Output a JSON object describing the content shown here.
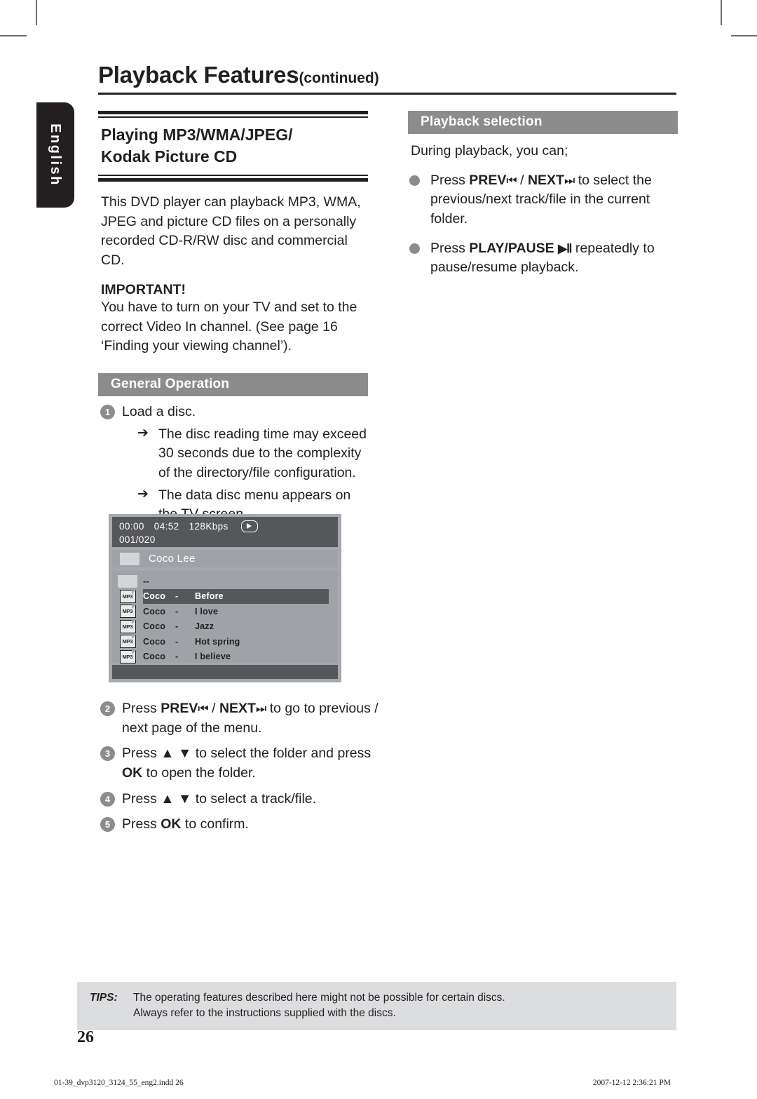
{
  "page": {
    "language_tab": "English",
    "header_title": "Playback Features",
    "header_continued": "(continued)",
    "page_number": "26"
  },
  "left_column": {
    "section_title_line1": "Playing MP3/WMA/JPEG/",
    "section_title_line2": "Kodak Picture CD",
    "intro_paragraph": "This DVD player can playback MP3, WMA, JPEG and picture CD files on a personally recorded CD-R/RW disc and commercial CD.",
    "important_label": "IMPORTANT!",
    "important_paragraph": "You have to turn on your TV and set to the correct Video In channel.  (See page 16 ‘Finding your viewing channel’).",
    "general_operation_bar": "General Operation",
    "steps": [
      {
        "num": "1",
        "text": "Load a disc.",
        "sub_items": [
          "The disc reading time may exceed 30 seconds due to the complexity of the directory/file configuration.",
          "The data disc menu appears on the TV screen."
        ]
      },
      {
        "num": "2",
        "text_pre": "Press ",
        "bold1": "PREV",
        "glyph1": "⏮",
        "mid": " / ",
        "bold2": "NEXT",
        "glyph2": "⏭",
        "text_post": " to go to previous / next page of the menu."
      },
      {
        "num": "3",
        "text_pre": "Press ",
        "glyph1": "▲",
        "glyph2": "▼",
        "mid": " to select the folder and press ",
        "bold1": "OK",
        "text_post": " to open the folder."
      },
      {
        "num": "4",
        "text_pre": "Press ",
        "glyph1": "▲",
        "glyph2": "▼",
        "text_post": " to select a track/file."
      },
      {
        "num": "5",
        "text_pre": "Press ",
        "bold1": "OK",
        "text_post": " to confirm."
      }
    ]
  },
  "tv_screen": {
    "status": {
      "elapsed_time": "00:00",
      "total_time": "04:52",
      "bitrate": "128Kbps",
      "play_icon": "play-icon",
      "track_counter": "001/020"
    },
    "current_folder": "Coco Lee",
    "rows": [
      {
        "icon": "folder-up-icon",
        "artist": "--",
        "dash": "",
        "title": "",
        "selected": false
      },
      {
        "icon": "mp3-file-icon",
        "label": "MP3",
        "artist": "Coco",
        "dash": "-",
        "title": "Before",
        "selected": true
      },
      {
        "icon": "mp3-file-icon",
        "label": "MP3",
        "artist": "Coco",
        "dash": "-",
        "title": "I love",
        "selected": false
      },
      {
        "icon": "mp3-file-icon",
        "label": "MP3",
        "artist": "Coco",
        "dash": "-",
        "title": "Jazz",
        "selected": false
      },
      {
        "icon": "mp3-file-icon",
        "label": "MP3",
        "artist": "Coco",
        "dash": "-",
        "title": "Hot spring",
        "selected": false
      },
      {
        "icon": "mp3-file-icon",
        "label": "MP3",
        "artist": "Coco",
        "dash": "-",
        "title": "I believe",
        "selected": false
      }
    ]
  },
  "right_column": {
    "playback_selection_bar": "Playback selection",
    "intro": "During playback, you can;",
    "bullets": [
      {
        "text_pre": "Press ",
        "bold1": "PREV",
        "glyph1": "⏮",
        "mid": " / ",
        "bold2": "NEXT",
        "glyph2": "⏭",
        "text_post": " to select the previous/next track/file in the current folder."
      },
      {
        "text_pre": "Press ",
        "bold1": "PLAY/PAUSE",
        "glyph1": "▶Ⅱ",
        "text_post": " repeatedly to pause/resume playback."
      }
    ]
  },
  "tips": {
    "label": "TIPS:",
    "line1": "The operating features described here might not be possible for certain discs.",
    "line2": "Always refer to the instructions supplied with the discs."
  },
  "print_footer": {
    "left": "01-39_dvp3120_3124_55_eng2.indd  26",
    "right": "2007-12-12  2:36:21 PM"
  },
  "colors": {
    "ink": "#231f20",
    "gray_bar": "#8c8c8c",
    "tv_background": "#a5a8ad",
    "tv_dark": "#55575b",
    "tips_background": "#dcdddf"
  }
}
